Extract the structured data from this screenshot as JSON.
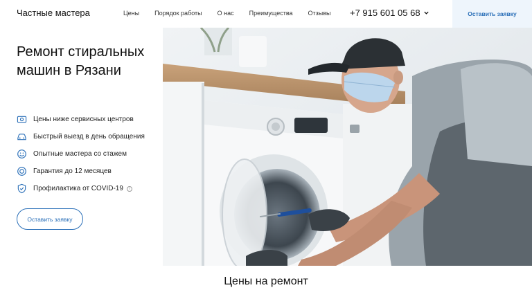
{
  "header": {
    "logo": "Частные мастера",
    "nav": [
      "Цены",
      "Порядок работы",
      "О нас",
      "Преимущества",
      "Отзывы"
    ],
    "phone": "+7 915 601 05 68",
    "cta": "Оставить заявку"
  },
  "hero": {
    "title": "Ремонт стиральных машин в Рязани",
    "features": [
      {
        "text": "Цены ниже сервисных центров",
        "icon": "money-icon"
      },
      {
        "text": "Быстрый выезд в день обращения",
        "icon": "car-icon"
      },
      {
        "text": "Опытные мастера со стажем",
        "icon": "smile-icon"
      },
      {
        "text": "Гарантия до 12 месяцев",
        "icon": "badge-icon"
      },
      {
        "text": "Профилактика от COVID-19",
        "icon": "shield-icon",
        "info": "i"
      }
    ],
    "cta": "Оставить заявку"
  },
  "sections": {
    "prices_title": "Цены на ремонт"
  },
  "colors": {
    "accent": "#2a6fb8",
    "cta_bg": "#eef5fc"
  }
}
